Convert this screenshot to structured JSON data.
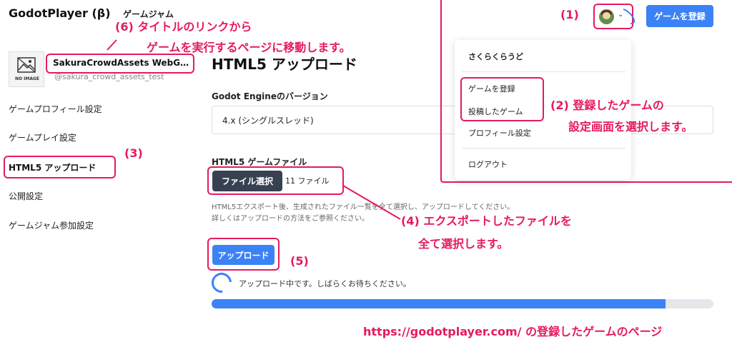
{
  "header": {
    "brand": "GodotPlayer (β)",
    "nav_jam": "ゲームジャム",
    "register_button": "ゲームを登録",
    "chevron": "⌄"
  },
  "sidebar": {
    "thumb_label": "NO IMAGE",
    "game_title": "SakuraCrowdAssets WebG…",
    "game_handle": "@sakura_crowd_assets_test",
    "items": [
      {
        "label": "ゲームプロフィール設定"
      },
      {
        "label": "ゲームプレイ設定"
      },
      {
        "label": "HTML5 アップロード"
      },
      {
        "label": "公開設定"
      },
      {
        "label": "ゲームジャム参加設定"
      }
    ]
  },
  "main": {
    "title": "HTML5 アップロード",
    "engine_label": "Godot Engineのバージョン",
    "engine_value": "4.x (シングルスレッド)",
    "file_label": "HTML5 ゲームファイル",
    "file_button": "ファイル選択",
    "file_count": "11 ファイル",
    "help_line1": "HTML5エクスポート後、生成されたファイル一覧を全て選択し、アップロードしてください。",
    "help_line2": "詳しくはアップロードの方法をご参照ください。",
    "upload_button": "アップロード",
    "uploading_text": "アップロード中です。しばらくお待ちください。",
    "progress_fraction": 0.904
  },
  "menu": {
    "user": "さくらくらうど",
    "items": [
      {
        "label": "ゲームを登録"
      },
      {
        "label": "投稿したゲーム"
      },
      {
        "label": "プロフィール設定"
      },
      {
        "label": "ログアウト"
      }
    ]
  },
  "annotations": {
    "a1": "(1)",
    "a2_line1": "(2) 登録したゲームの",
    "a2_line2": "設定画面を選択します。",
    "a3": "(3)",
    "a4_line1": "(4) エクスポートしたファイルを",
    "a4_line2": "全て選択します。",
    "a5": "(5)",
    "a6_line1": "(6) タイトルのリンクから",
    "a6_line2": "ゲームを実行するページに移動します。",
    "footer": "https://godotplayer.com/ の登録したゲームのページ"
  },
  "colors": {
    "accent": "#3b82f6",
    "annotation": "#e6195f",
    "dark_button": "#374151"
  }
}
